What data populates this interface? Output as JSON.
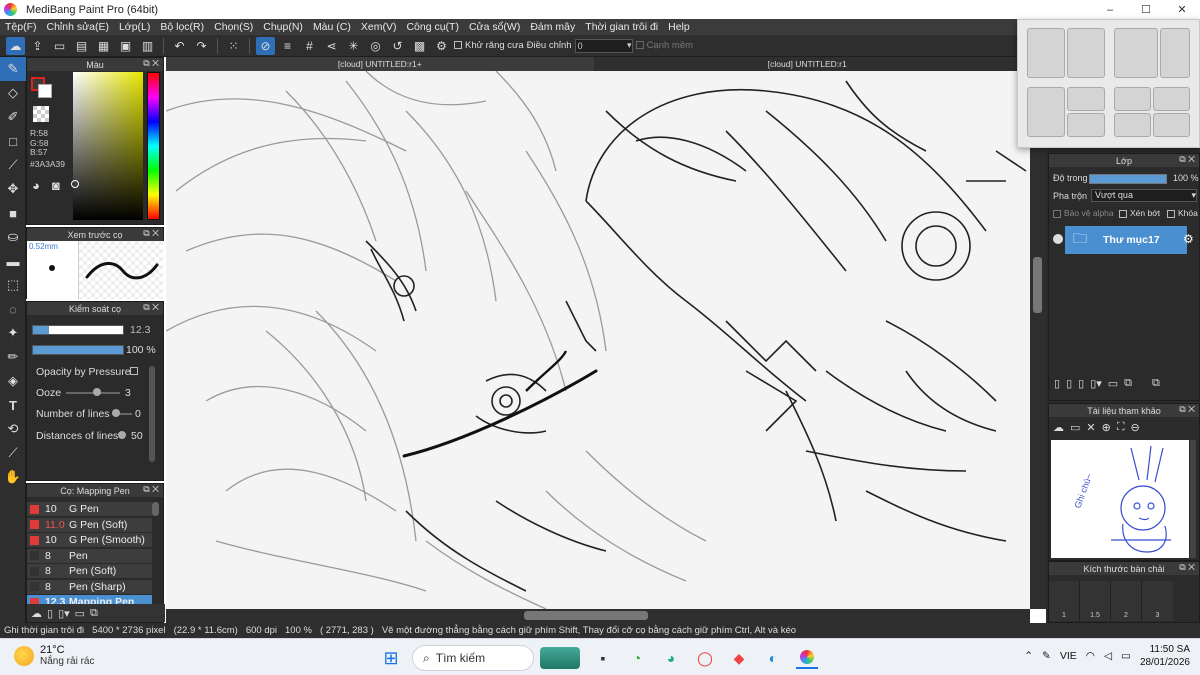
{
  "window": {
    "title": "MediBang Paint Pro (64bit)",
    "controls": [
      "–",
      "☐",
      "✕"
    ]
  },
  "menu": [
    "Tệp(F)",
    "Chỉnh sửa(E)",
    "Lớp(L)",
    "Bộ lọc(R)",
    "Chọn(S)",
    "Chụp(N)",
    "Màu (C)",
    "Xem(V)",
    "Công cụ(T)",
    "Cửa sổ(W)",
    "Đám mây",
    "Thời gian trôi đi",
    "Help"
  ],
  "toolbar": {
    "antialias_label": "Khử răng cưa",
    "correction_label": "Điều chỉnh",
    "correction_value": "0",
    "edge_label": "Cạnh mềm"
  },
  "color_panel": {
    "title": "Màu",
    "r": "R:58",
    "g": "G:58",
    "b": "B:57",
    "hex": "#3A3A39",
    "current": "#3a3a39"
  },
  "brush_preview": {
    "title": "Xem trước cọ",
    "size": "0.52mm"
  },
  "brush_control": {
    "title": "Kiểm soát cọ",
    "size_value": "12.3",
    "size_fill": 0.18,
    "opacity_value": "100 %",
    "opacity_fill": 1.0,
    "opacity_by_pressure": "Opacity by Pressure",
    "ooze_label": "Ooze",
    "ooze_value": "3",
    "lines_label": "Number of lines",
    "lines_value": "0",
    "distance_label": "Distances of lines",
    "distance_value": "50"
  },
  "brush_list": {
    "title": "Cọ: Mapping Pen",
    "items": [
      {
        "size": "10",
        "name": "G Pen",
        "color": "#e03a3a"
      },
      {
        "size": "11.0",
        "name": "G Pen (Soft)",
        "color": "#e03a3a"
      },
      {
        "size": "10",
        "name": "G Pen (Smooth)",
        "color": "#e03a3a"
      },
      {
        "size": "8",
        "name": "Pen",
        "color": "#333333"
      },
      {
        "size": "8",
        "name": "Pen (Soft)",
        "color": "#333333"
      },
      {
        "size": "8",
        "name": "Pen (Sharp)",
        "color": "#333333"
      },
      {
        "size": "12.3",
        "name": "Mapping Pen",
        "color": "#e03a3a"
      }
    ]
  },
  "tabs": [
    "[cloud] UNTITLED:r1+",
    "[cloud] UNTITLED:r1"
  ],
  "layer_panel": {
    "title": "Lớp",
    "opacity_label": "Độ trong",
    "opacity_value": "100 %",
    "blend_label": "Pha trộn",
    "blend_value": "Vượt qua",
    "protect_alpha": "Bảo vệ alpha",
    "clipping": "Xén bớt",
    "lock": "Khóa",
    "layer_name": "Thư mục17"
  },
  "reference_panel": {
    "title": "Tài liệu tham khảo",
    "sketch_text": "Ghi chú~"
  },
  "brush_size_panel": {
    "title": "Kích thước bàn chải",
    "sizes": [
      "1",
      "1.5",
      "2",
      "3"
    ]
  },
  "status": {
    "elapsed": "Ghi thời gian trôi đi",
    "dims": "5400 * 2736 pixel",
    "cm": "(22.9 * 11.6cm)",
    "dpi": "600 dpi",
    "zoom": "100 %",
    "coords": "( 2771, 283 )",
    "hint": "Vẽ một đường thẳng bằng cách giữ phím Shift, Thay đổi cỡ cọ bằng cách giữ phím Ctrl, Alt và kéo"
  },
  "taskbar": {
    "temp": "21°C",
    "weather": "Nắng rải rác",
    "search": "Tìm kiếm",
    "lang": "VIE",
    "time": "11:50 SA",
    "date": "28/01/2026"
  }
}
